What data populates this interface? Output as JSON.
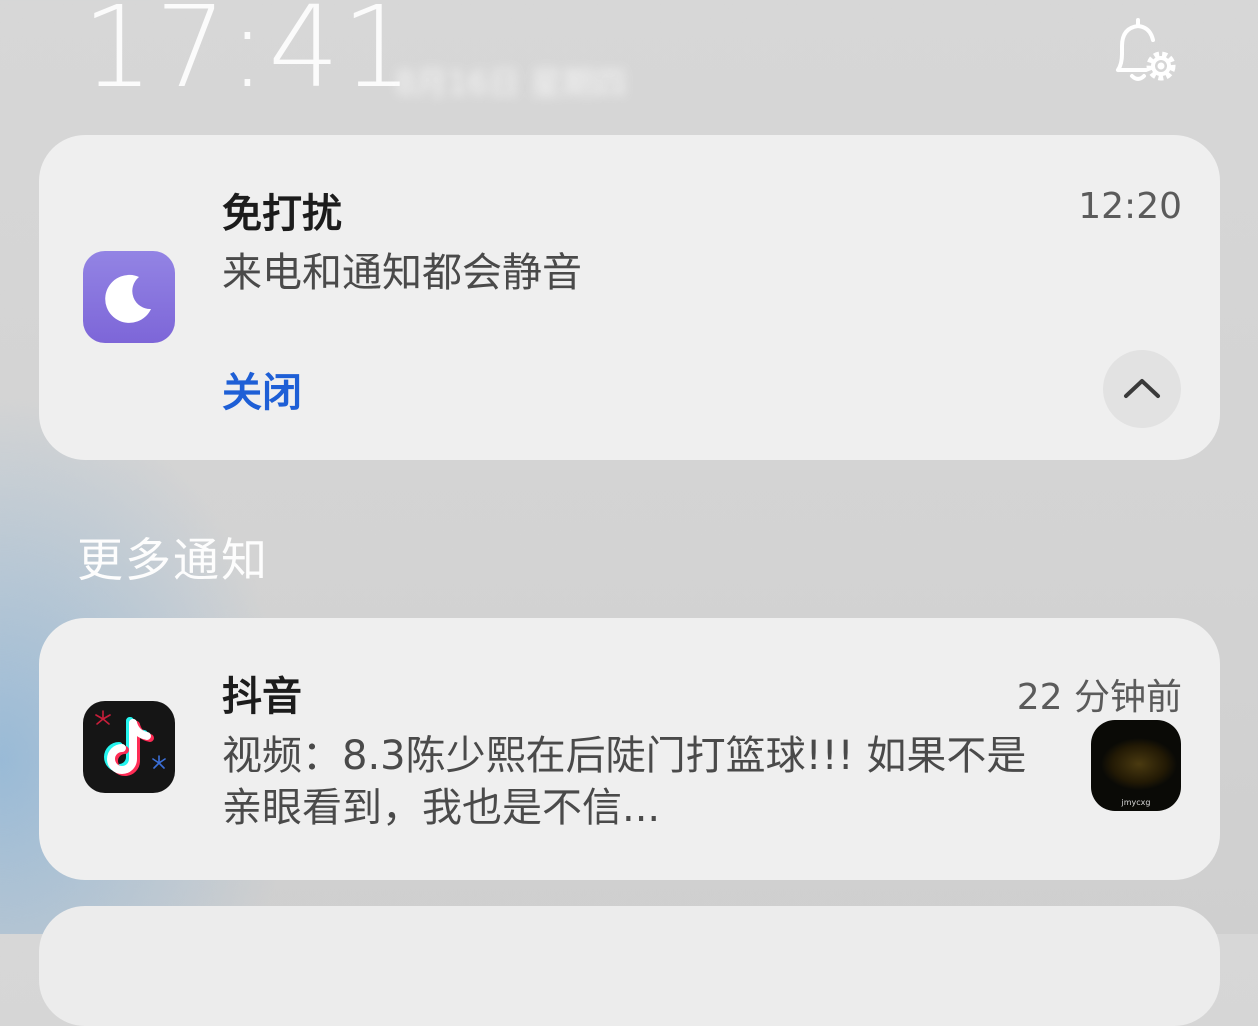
{
  "status": {
    "clock": "17:41",
    "date_text": "8月16日 星期四"
  },
  "pinned": {
    "app_name": "免打扰",
    "time": "12:20",
    "message": "来电和通知都会静音",
    "action_label": "关闭"
  },
  "section_title": "更多通知",
  "notifications": [
    {
      "app_name": "抖音",
      "time": "22 分钟前",
      "message": "视频：8.3陈少熙在后陡门打篮球!!! 如果不是亲眼看到，我也是不信...",
      "thumb_caption": "jmycxg"
    }
  ],
  "colors": {
    "accent": "#1e5fd6",
    "dnd_icon": "#8a76df",
    "card_bg": "#efefef"
  },
  "icons": {
    "header": "bell-settings-icon",
    "pinned": "moon-icon",
    "collapse": "chevron-up-icon",
    "app": "tiktok-icon"
  }
}
